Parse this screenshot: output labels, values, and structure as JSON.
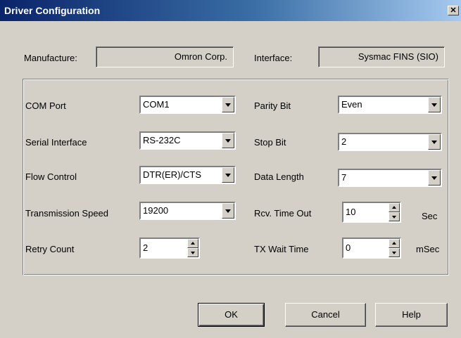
{
  "window": {
    "title": "Driver Configuration"
  },
  "header": {
    "manufacture_label": "Manufacture:",
    "manufacture_value": "Omron Corp.",
    "interface_label": "Interface:",
    "interface_value": "Sysmac FINS (SIO)"
  },
  "settings": {
    "com_port": {
      "label": "COM Port",
      "value": "COM1"
    },
    "serial_interface": {
      "label": "Serial Interface",
      "value": "RS-232C"
    },
    "flow_control": {
      "label": "Flow Control",
      "value": "DTR(ER)/CTS"
    },
    "transmission_speed": {
      "label": "Transmission Speed",
      "value": "19200"
    },
    "retry_count": {
      "label": "Retry Count",
      "value": "2"
    },
    "parity_bit": {
      "label": "Parity Bit",
      "value": "Even"
    },
    "stop_bit": {
      "label": "Stop Bit",
      "value": "2"
    },
    "data_length": {
      "label": "Data Length",
      "value": "7"
    },
    "rcv_time_out": {
      "label": "Rcv. Time Out",
      "value": "10",
      "unit": "Sec"
    },
    "tx_wait_time": {
      "label": "TX Wait Time",
      "value": "0",
      "unit": "mSec"
    }
  },
  "buttons": {
    "ok": "OK",
    "cancel": "Cancel",
    "help": "Help"
  }
}
